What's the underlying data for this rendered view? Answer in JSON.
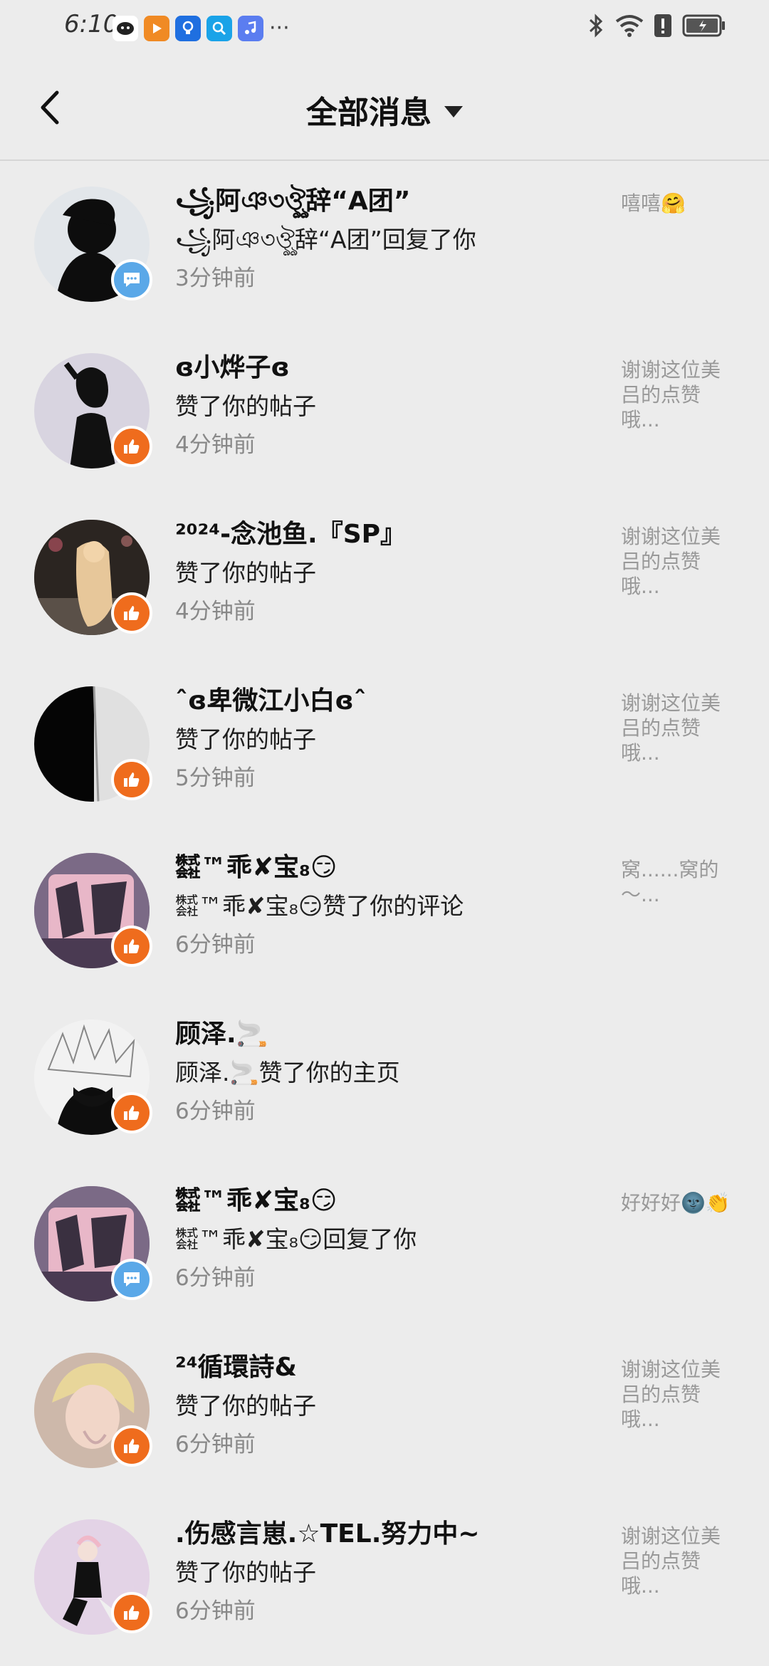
{
  "status_bar": {
    "time": "6:10",
    "more": "···"
  },
  "header": {
    "title": "全部消息"
  },
  "messages": [
    {
      "name": "꧁阿ঞ৩ঔৣ辞“A团”",
      "action": "꧁阿ঞ৩ঔৣ辞“A团”回复了你",
      "time": "3分钟前",
      "preview": "嘻嘻🤗",
      "badge": "comment"
    },
    {
      "name": "ɞ小烨子ɞ",
      "action": "赞了你的帖子",
      "time": "4分钟前",
      "preview": "谢谢这位美吕的点赞哦...",
      "badge": "like"
    },
    {
      "name": "²⁰²⁴-念池鱼.『SP』",
      "action": "赞了你的帖子",
      "time": "4分钟前",
      "preview": "谢谢这位美吕的点赞哦...",
      "badge": "like"
    },
    {
      "name": "ˆɞ卑微江小白ɞˆ",
      "action": "赞了你的帖子",
      "time": "5分钟前",
      "preview": "谢谢这位美吕的点赞哦...",
      "badge": "like"
    },
    {
      "name": "㍿™乖✘宝₈😏",
      "action": "㍿™乖✘宝₈😏赞了你的评论",
      "time": "6分钟前",
      "preview": "窝......窝的～...",
      "badge": "like"
    },
    {
      "name": "顾泽.🚬",
      "action": "顾泽.🚬赞了你的主页",
      "time": "6分钟前",
      "preview": "",
      "badge": "like"
    },
    {
      "name": "㍿™乖✘宝₈😏",
      "action": "㍿™乖✘宝₈😏回复了你",
      "time": "6分钟前",
      "preview": "好好好🌚👏",
      "badge": "comment"
    },
    {
      "name": "²⁴循環詩&",
      "action": "赞了你的帖子",
      "time": "6分钟前",
      "preview": "谢谢这位美吕的点赞哦...",
      "badge": "like"
    },
    {
      "name": ".伤感言崽.☆TEL.努力中~",
      "action": "赞了你的帖子",
      "time": "6分钟前",
      "preview": "谢谢这位美吕的点赞哦...",
      "badge": "like"
    }
  ],
  "colors": {
    "background": "#ececec",
    "like_badge": "#ef6c1d",
    "comment_badge": "#5aa8e8"
  }
}
